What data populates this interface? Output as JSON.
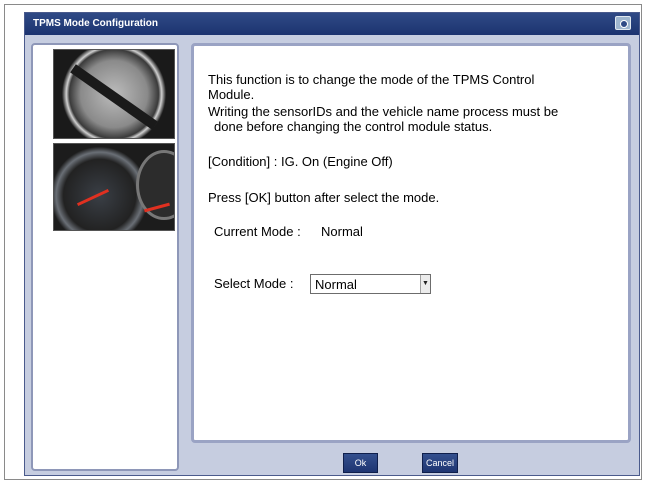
{
  "window": {
    "title": "TPMS Mode Configuration"
  },
  "content": {
    "description_lines": [
      "This function is to change the mode of the TPMS Control",
      "Module.",
      "Writing the sensorIDs and the vehicle name process must be",
      "done before changing the control module status."
    ],
    "condition": "[Condition] : IG. On (Engine Off)",
    "instruction": "Press [OK] button after select the mode.",
    "current_mode_label": "Current Mode :",
    "current_mode_value": "Normal",
    "select_mode_label": "Select Mode :",
    "select_mode_value": "Normal"
  },
  "buttons": {
    "ok": "Ok",
    "cancel": "Cancel"
  },
  "colors": {
    "titlebar": "#2f4a86",
    "window_bg": "#c6cde0",
    "button": "#1e3572"
  },
  "icons": {
    "title_icon": "camera-icon",
    "select_arrow": "chevron-down-icon"
  }
}
